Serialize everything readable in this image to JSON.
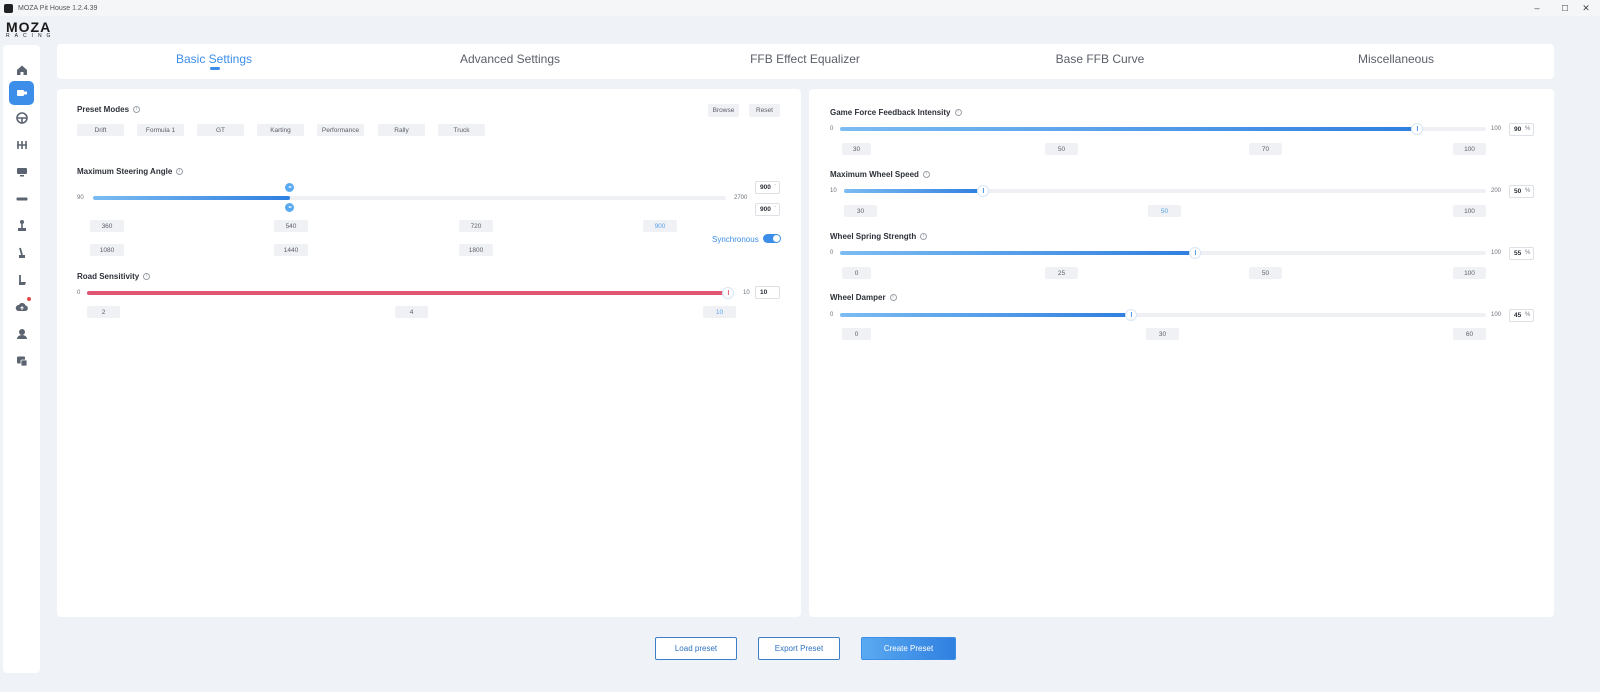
{
  "window": {
    "title": "MOZA Pit House 1.2.4.39",
    "minimize": "–",
    "maximize": "☐",
    "close": "✕"
  },
  "brand": {
    "line1": "MOZA",
    "line2": "RACING"
  },
  "sidebar": {
    "items": [
      {
        "icon": "home-icon",
        "active": false
      },
      {
        "icon": "wheelbase-icon",
        "active": true
      },
      {
        "icon": "steering-wheel-icon",
        "active": false
      },
      {
        "icon": "pedals-icon",
        "active": false
      },
      {
        "icon": "dashboard-icon",
        "active": false
      },
      {
        "icon": "shifter-bar-icon",
        "active": false
      },
      {
        "icon": "shifter-icon",
        "active": false
      },
      {
        "icon": "handbrake-icon",
        "active": false
      },
      {
        "icon": "sequential-shifter-icon",
        "active": false
      },
      {
        "icon": "cloud-upload-icon",
        "active": false,
        "badge": true
      },
      {
        "icon": "profile-icon",
        "active": false
      },
      {
        "icon": "feedback-icon",
        "active": false
      }
    ]
  },
  "tabs": [
    {
      "label": "Basic Settings",
      "active": true
    },
    {
      "label": "Advanced Settings",
      "active": false
    },
    {
      "label": "FFB Effect Equalizer",
      "active": false
    },
    {
      "label": "Base FFB Curve",
      "active": false
    },
    {
      "label": "Miscellaneous",
      "active": false
    }
  ],
  "left": {
    "preset_modes": {
      "label": "Preset Modes",
      "browse": "Browse",
      "reset": "Reset",
      "modes": [
        "Drift",
        "Formula 1",
        "GT",
        "Karting",
        "Performance",
        "Rally",
        "Truck"
      ]
    },
    "steering_angle": {
      "label": "Maximum Steering Angle",
      "min": "90",
      "max": "2700",
      "value_top": "900",
      "value_bottom": "900",
      "knob_top": "900",
      "knob_bottom": "900",
      "fraction": 0.311,
      "presets_row1": [
        "360",
        "540",
        "720",
        "900"
      ],
      "presets_row2": [
        "1080",
        "1440",
        "1800"
      ],
      "selected": "900",
      "sync_label": "Synchronous",
      "sync_on": true
    },
    "road_sensitivity": {
      "label": "Road Sensitivity",
      "min": "0",
      "max": "10",
      "value": "10",
      "fraction": 1.0,
      "presets": [
        "2",
        "4",
        "10"
      ],
      "selected": "10"
    }
  },
  "right": {
    "game_ffb": {
      "label": "Game Force Feedback Intensity",
      "min": "0",
      "max": "100",
      "value": "90",
      "unit": "%",
      "fraction": 0.9,
      "presets": [
        "30",
        "50",
        "70",
        "100"
      ]
    },
    "wheel_speed": {
      "label": "Maximum Wheel Speed",
      "min": "10",
      "max": "200",
      "value": "50",
      "unit": "%",
      "fraction": 0.211,
      "presets": [
        "30",
        "50",
        "100"
      ],
      "selected": "50"
    },
    "spring": {
      "label": "Wheel Spring Strength",
      "min": "0",
      "max": "100",
      "value": "55",
      "unit": "%",
      "fraction": 0.55,
      "presets": [
        "0",
        "25",
        "50",
        "100"
      ]
    },
    "damper": {
      "label": "Wheel Damper",
      "min": "0",
      "max": "100",
      "value": "45",
      "unit": "%",
      "fraction": 0.45,
      "presets": [
        "0",
        "30",
        "60"
      ]
    }
  },
  "footer": {
    "load": "Load preset",
    "export": "Export Preset",
    "create": "Create Preset"
  },
  "colors": {
    "accent": "#3d8ee8",
    "road_fill": "#e05672",
    "panel_bg": "#ffffff",
    "page_bg": "#eff2f6"
  }
}
